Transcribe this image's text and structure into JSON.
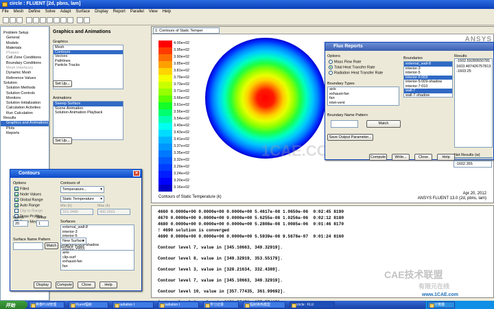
{
  "window": {
    "title": "circle : FLUENT  [2d, pbns, lam]"
  },
  "menu": [
    "File",
    "Mesh",
    "Define",
    "Solve",
    "Adapt",
    "Surface",
    "Display",
    "Report",
    "Parallel",
    "View",
    "Help"
  ],
  "nav": {
    "items": [
      {
        "label": "Problem Setup",
        "indent": false,
        "state": ""
      },
      {
        "label": "General",
        "indent": true,
        "state": ""
      },
      {
        "label": "Models",
        "indent": true,
        "state": ""
      },
      {
        "label": "Materials",
        "indent": true,
        "state": ""
      },
      {
        "label": "Phases",
        "indent": true,
        "state": "dim"
      },
      {
        "label": "Cell Zone Conditions",
        "indent": true,
        "state": ""
      },
      {
        "label": "Boundary Conditions",
        "indent": true,
        "state": ""
      },
      {
        "label": "Mesh Interfaces",
        "indent": true,
        "state": "dim"
      },
      {
        "label": "Dynamic Mesh",
        "indent": true,
        "state": ""
      },
      {
        "label": "Reference Values",
        "indent": true,
        "state": ""
      },
      {
        "label": "Solution",
        "indent": false,
        "state": ""
      },
      {
        "label": "Solution Methods",
        "indent": true,
        "state": ""
      },
      {
        "label": "Solution Controls",
        "indent": true,
        "state": ""
      },
      {
        "label": "Monitors",
        "indent": true,
        "state": ""
      },
      {
        "label": "Solution Initialization",
        "indent": true,
        "state": ""
      },
      {
        "label": "Calculation Activities",
        "indent": true,
        "state": ""
      },
      {
        "label": "Run Calculation",
        "indent": true,
        "state": ""
      },
      {
        "label": "Results",
        "indent": false,
        "state": ""
      },
      {
        "label": "Graphics and Animations",
        "indent": true,
        "state": "sel"
      },
      {
        "label": "Plots",
        "indent": true,
        "state": ""
      },
      {
        "label": "Reports",
        "indent": true,
        "state": ""
      }
    ]
  },
  "task": {
    "title": "Graphics and Animations",
    "graphics_label": "Graphics",
    "graphics_items": [
      "Mesh",
      "Contours",
      "Vectors",
      "Pathlines",
      "Particle Tracks"
    ],
    "graphics_selected": 1,
    "setup1": "Set Up...",
    "animations_label": "Animations",
    "animations_items": [
      "Sweep Surface",
      "Scene Animation",
      "Solution Animation Playback"
    ],
    "animations_selected": 0,
    "setup2": "Set Up..."
  },
  "graphics": {
    "tab_select": "1: Contours of Static Temper",
    "legend_values": [
      "4.00e+02",
      "3.95e+02",
      "3.90e+02",
      "3.85e+02",
      "3.81e+02",
      "3.79e+02",
      "3.73e+02",
      "3.71e+02",
      "3.66e+02",
      "3.61e+02",
      "3.56e+02",
      "3.54e+02",
      "3.49e+02",
      "3.43e+02",
      "3.41e+02",
      "3.37e+02",
      "3.35e+02",
      "3.32e+02",
      "3.29e+02",
      "3.24e+02",
      "3.20e+02",
      "3.16e+02"
    ],
    "legend_colors": [
      "#ff0000",
      "#ff3a00",
      "#ff6e00",
      "#ffa000",
      "#ffd400",
      "#f4ff00",
      "#c8ff00",
      "#96ff00",
      "#5aff00",
      "#14ff28",
      "#00ff6e",
      "#00ffb4",
      "#00fff0",
      "#00dcff",
      "#00b4ff",
      "#0096ff",
      "#0078ff",
      "#005aff",
      "#003cff",
      "#001eff",
      "#0000ff",
      "#0000c8"
    ],
    "caption": "Contours of Static Temperature (k)",
    "date": "Apr 20, 2012",
    "version": "ANSYS FLUENT 13.0 (2d, pbns, lam)",
    "logo": "ANSYS",
    "watermark": "1CAE.COM"
  },
  "flux": {
    "title": "Flux Reports",
    "options_label": "Options",
    "options": [
      "Mass Flow Rate",
      "Total Heat Transfer Rate",
      "Radiation Heat Transfer Rate"
    ],
    "option_selected": 1,
    "boundary_types_label": "Boundary Types",
    "boundary_types": [
      "axis",
      "exhaust-fan",
      "fan",
      "inlet-vent"
    ],
    "bnp_label": "Boundary Name Pattern",
    "match": "Match",
    "save": "Save Output Parameter...",
    "boundaries_label": "Boundaries",
    "boundaries": [
      "external_wall-8",
      "interior-3",
      "interior-5",
      "interior-5:009",
      "interior-5:009-shadow",
      "interior-7:010",
      "wall-7",
      "wall-7-shadow"
    ],
    "boundaries_selected": [
      0,
      3,
      6
    ],
    "results_label": "Results",
    "results": [
      "-1602.59289550781",
      "",
      "1603.487426757813",
      "",
      "-1603.25"
    ],
    "net_label": "Net Results (w)",
    "net_value": "-1602.355",
    "buttons": [
      "Compute",
      "Write...",
      "Close",
      "Help"
    ]
  },
  "contours": {
    "title": "Contours",
    "options_label": "Options",
    "options": [
      {
        "label": "Filled",
        "on": true,
        "dis": false
      },
      {
        "label": "Node Values",
        "on": true,
        "dis": false
      },
      {
        "label": "Global Range",
        "on": true,
        "dis": false
      },
      {
        "label": "Auto Range",
        "on": true,
        "dis": false
      },
      {
        "label": "Clip to Range",
        "on": false,
        "dis": true
      },
      {
        "label": "Draw Profiles",
        "on": false,
        "dis": false
      },
      {
        "label": "Draw Mesh",
        "on": false,
        "dis": false
      }
    ],
    "contours_of_label": "Contours of",
    "contours_of": "Temperature...",
    "field": "Static Temperature",
    "min_label": "Min (k)",
    "max_label": "Max (k)",
    "min_value": "315.9486",
    "max_value": "400.0001",
    "levels_label": "Levels",
    "levels": "20",
    "setup_label": "Setup",
    "setup": "1",
    "surfaces_label": "Surfaces",
    "surfaces": [
      "external_wall-8",
      "interior-3",
      "interior-5",
      "interior-5:009",
      "interior-5:009-shadow",
      "interior-7:010"
    ],
    "snp_label": "Surface Name Pattern",
    "match": "Match",
    "new_surface": "New Surface",
    "surface_types_label": "Surface Types",
    "surface_types": [
      "axis",
      "clip-surf",
      "exhaust-fan",
      "fan"
    ],
    "buttons": [
      "Display",
      "Compute",
      "Close",
      "Help"
    ]
  },
  "console": {
    "lines": [
      "4660 0.0000e+00 0.0000e+00 0.0000e+00 5.4617e-08 1.0650e-06  0:02:45 8190",
      "4670 0.0000e+00 0.0000e+00 0.0000e+00 5.6255e-08 1.0256e-06  0:02:12 8180",
      "4680 0.0000e+00 0.0000e+00 0.0000e+00 5.2808e-08 1.0085e-06  0:01:46 8170",
      "! 4690 solution is converged",
      "4690 0.0000e+00 0.0000e+00 0.0000e+00 5.5939e-08 9.5678e-07  0:01:24 8160",
      "",
      "Contour level 7, value in [345.10663, 349.32919].",
      "",
      "Contour level 8, value in [349.32919, 353.55179].",
      "",
      "Contour level 3, value in [328.21634, 332.4389].",
      "",
      "Contour level 7, value in [345.10663, 349.32919].",
      "",
      "Contour level 10, value in [357.77435, 361.99692].",
      "",
      "Contour level 9, value in [353.55179, 357.77435]."
    ],
    "watermark": "CAE技术联盟",
    "watermark2": "有限元在线",
    "watermark3": "www.1CAE.com"
  },
  "taskbar": {
    "start": "开始",
    "tasks": [
      "英泰PLM管理",
      "Fluent辐射",
      "radiation t",
      "radiation t",
      "学习记录",
      "辐射换热模型",
      "circle : FLU"
    ],
    "active": 6,
    "tray_item": "计算器"
  }
}
